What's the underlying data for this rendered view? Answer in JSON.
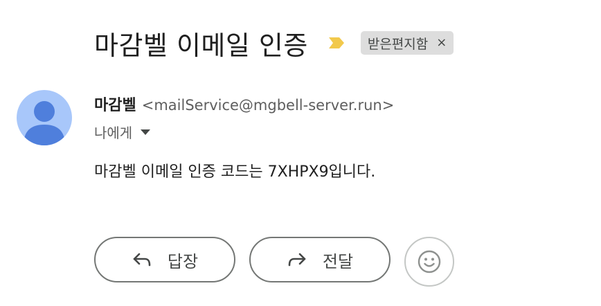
{
  "email": {
    "subject": "마감벨 이메일 인증",
    "label": "받은편지함",
    "label_remove": "×",
    "sender_name": "마감벨",
    "sender_email": "<mailService@mgbell-server.run>",
    "recipient": "나에게",
    "body": "마감벨 이메일 인증 코드는 7XHPX9입니다."
  },
  "actions": {
    "reply_label": "답장",
    "forward_label": "전달"
  },
  "colors": {
    "importance_marker": "#f2c94c",
    "avatar_bg": "#a8c7fa",
    "avatar_fg": "#4f7fdc",
    "chip_bg": "#dddddd"
  },
  "icons": {
    "importance": "importance-marker-icon",
    "avatar": "person-icon",
    "recipient_toggle": "caret-down-icon",
    "reply": "reply-arrow-icon",
    "forward": "forward-arrow-icon",
    "emoji": "smiley-icon"
  }
}
